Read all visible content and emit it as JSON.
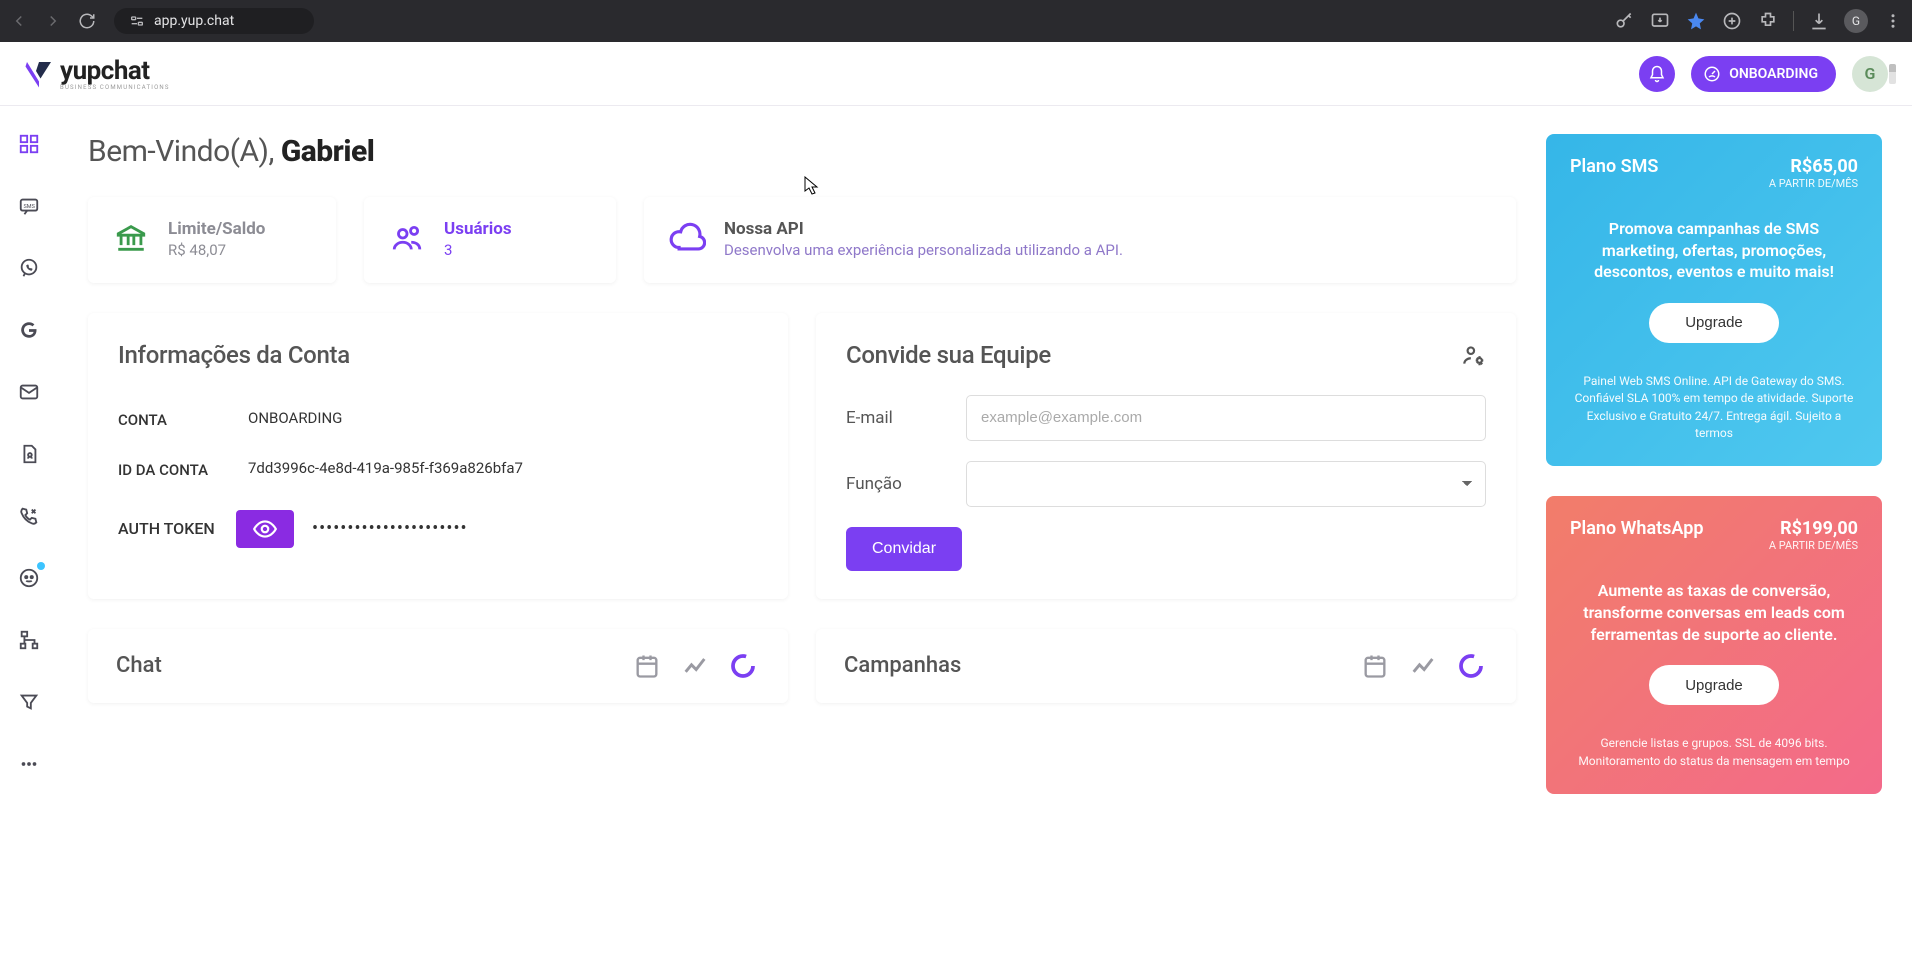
{
  "browser": {
    "url": "app.yup.chat",
    "profile_initial": "G"
  },
  "header": {
    "logo_text": "yupchat",
    "logo_sub": "BUSINESS COMMUNICATIONS",
    "onboarding_label": "ONBOARDING",
    "avatar_initial": "G"
  },
  "welcome": {
    "greeting": "Bem-Vindo(A), ",
    "name": "Gabriel"
  },
  "stats": {
    "balance": {
      "label": "Limite/Saldo",
      "value": "R$ 48,07"
    },
    "users": {
      "label": "Usuários",
      "value": "3"
    },
    "api": {
      "label": "Nossa API",
      "sub": "Desenvolva uma experiência personalizada utilizando a API."
    }
  },
  "account_info": {
    "title": "Informações da Conta",
    "account_label": "CONTA",
    "account_value": "ONBOARDING",
    "id_label": "ID DA CONTA",
    "id_value": "7dd3996c-4e8d-419a-985f-f369a826bfa7",
    "auth_label": "AUTH TOKEN",
    "auth_masked": "••••••••••••••••••••••"
  },
  "invite": {
    "title": "Convide sua Equipe",
    "email_label": "E-mail",
    "email_placeholder": "example@example.com",
    "role_label": "Função",
    "button": "Convidar"
  },
  "bottom": {
    "chat_title": "Chat",
    "campaigns_title": "Campanhas"
  },
  "plans": {
    "sms": {
      "name": "Plano SMS",
      "price": "R$65,00",
      "price_sub": "A PARTIR DE/MÊS",
      "desc": "Promova campanhas de SMS marketing, ofertas, promoções, descontos, eventos e muito mais!",
      "upgrade": "Upgrade",
      "foot": "Painel Web SMS Online. API de Gateway do SMS. Confiável SLA 100% em tempo de atividade. Suporte Exclusivo e Gratuito 24/7. Entrega ágil. Sujeito a termos"
    },
    "wa": {
      "name": "Plano WhatsApp",
      "price": "R$199,00",
      "price_sub": "A PARTIR DE/MÊS",
      "desc": "Aumente as taxas de conversão, transforme conversas em leads com ferramentas de suporte ao cliente.",
      "upgrade": "Upgrade",
      "foot": "Gerencie listas e grupos. SSL de 4096 bits. Monitoramento do status da mensagem em tempo"
    }
  }
}
